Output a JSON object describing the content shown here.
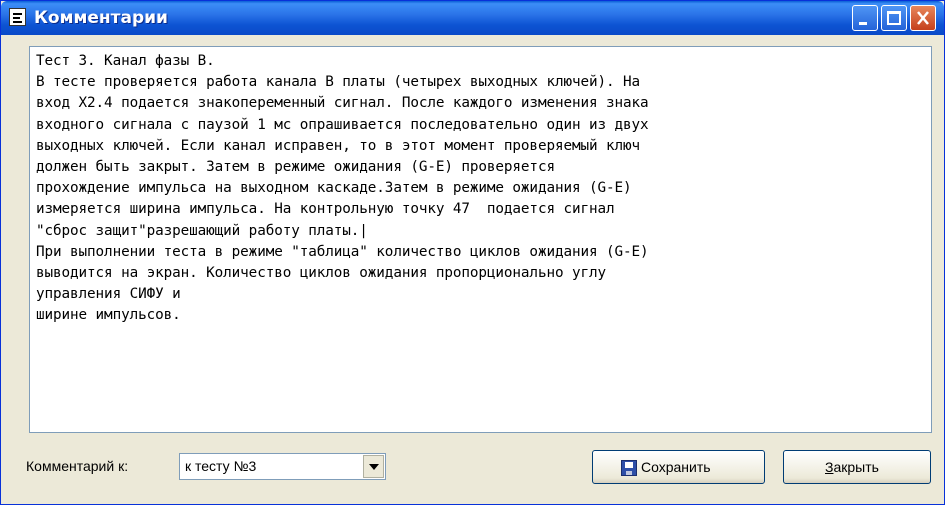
{
  "window": {
    "title": "Комментарии"
  },
  "comment": {
    "lines": [
      "Тест 3. Канал фазы В.",
      "В тесте проверяется работа канала В платы (четырех выходных ключей). На",
      "вход Х2.4 подается знакопеременный сигнал. После каждого изменения знака",
      "входного сигнала с паузой 1 мс опрашивается последовательно один из двух",
      "выходных ключей. Если канал исправен, то в этот момент проверяемый ключ",
      "должен быть закрыт. Затем в режиме ожидания (G-E) проверяется",
      "прохождение импульса на выходном каскаде.Затем в режиме ожидания (G-E)",
      "измеряется ширина импульса. На контрольную точку 47  подается сигнал",
      "\"сброс защит\"разрешающий работу платы.|",
      "При выполнении теста в режиме \"таблица\" количество циклов ожидания (G-E)",
      "выводится на экран. Количество циклов ожидания пропорционально углу",
      "управления СИФУ и",
      "ширине импульсов."
    ]
  },
  "footer": {
    "label": "Комментарий к:",
    "combo_value": "к тесту №3",
    "save_label": "Сохранить",
    "close_label": "Закрыть"
  }
}
